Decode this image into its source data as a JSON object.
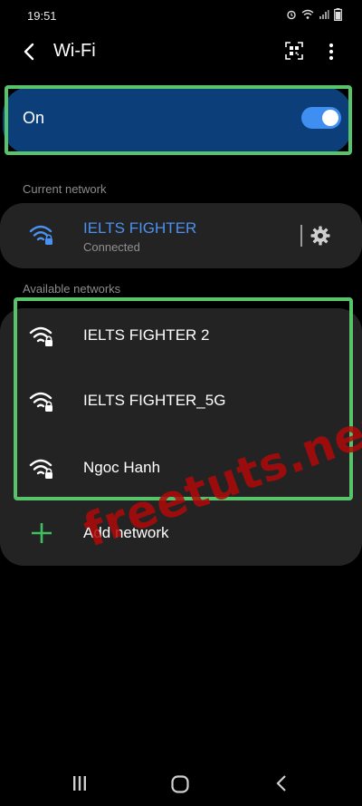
{
  "status_bar": {
    "time": "19:51",
    "icons": [
      "alarm-icon",
      "wifi-icon",
      "signal-icon",
      "battery-icon"
    ]
  },
  "app_bar": {
    "title": "Wi-Fi",
    "back_icon": "back-arrow-icon",
    "qr_icon": "qr-scan-icon",
    "more_icon": "more-vert-icon"
  },
  "wifi_toggle": {
    "label": "On",
    "state": true
  },
  "current_network": {
    "section_label": "Current network",
    "name": "IELTS FIGHTER",
    "status": "Connected",
    "settings_icon": "gear-icon"
  },
  "available_networks": {
    "section_label": "Available networks",
    "items": [
      {
        "name": "IELTS FIGHTER 2",
        "icon": "wifi-lock-icon"
      },
      {
        "name": "IELTS FIGHTER_5G",
        "icon": "wifi-lock-icon"
      },
      {
        "name": "Ngoc Hanh",
        "icon": "wifi-lock-icon"
      }
    ],
    "add_label": "Add network"
  },
  "watermark": "freetuts.net",
  "colors": {
    "background": "#000000",
    "card": "#232323",
    "toggle_card": "#0c3f79",
    "accent": "#4b92f0",
    "highlight": "#57c36a",
    "add_icon": "#3fbf5f",
    "watermark": "#b00a0a"
  },
  "nav_bar": {
    "recents_icon": "recents-icon",
    "home_icon": "home-icon",
    "back_icon": "nav-back-icon"
  }
}
